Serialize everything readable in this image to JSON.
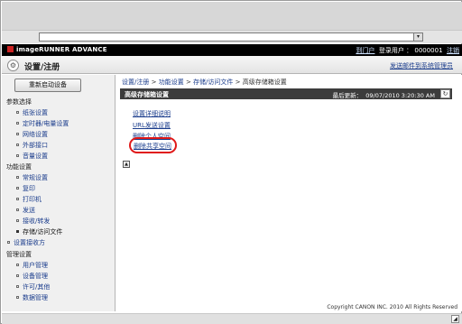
{
  "browser": {
    "address_dropdown_icon": "chevron-down-icon"
  },
  "header": {
    "brand": "imageRUNNER ADVANCE",
    "portal_link": "到门户",
    "login_user_label": "登录用户 ：",
    "user_id": "0000001",
    "logout_link": "注销"
  },
  "title": {
    "icon": "settings-gear-icon",
    "text": "设置/注册",
    "email_link": "发送邮件到系统管理员"
  },
  "sidebar": {
    "restart_button": "重新启动设备",
    "preferences_header": "参数选择",
    "preferences_items": [
      {
        "label": "纸张设置"
      },
      {
        "label": "定时器/电量设置"
      },
      {
        "label": "网络设置"
      },
      {
        "label": "外部接口"
      },
      {
        "label": "音量设置"
      }
    ],
    "function_header": "功能设置",
    "function_items": [
      {
        "label": "常规设置"
      },
      {
        "label": "复印"
      },
      {
        "label": "打印机"
      },
      {
        "label": "发送"
      },
      {
        "label": "接收/转发"
      },
      {
        "label": "存储/访问文件"
      }
    ],
    "dest_item": "设置接收方",
    "management_header": "管理设置",
    "management_items": [
      {
        "label": "用户管理"
      },
      {
        "label": "设备管理"
      },
      {
        "label": "许可/其他"
      },
      {
        "label": "数据管理"
      }
    ]
  },
  "content": {
    "breadcrumb": {
      "home": "设置/注册",
      "level1": "功能设置",
      "level2": "存储/访问文件",
      "current": "高级存储箱设置",
      "separator": ">"
    },
    "section_title": "高级存储箱设置",
    "last_update_label": "最后更新：",
    "last_update_value": "09/07/2010 3:20:30 AM",
    "refresh_icon": "refresh-icon",
    "links": [
      {
        "label": "设置详细说明"
      },
      {
        "label": "URL发送设置"
      },
      {
        "label": "删除个人空间"
      },
      {
        "label": "删除共享空间"
      }
    ],
    "up_icon": "arrow-up-icon"
  },
  "footer": {
    "copyright": "Copyright CANON INC. 2010 All Rights Reserved"
  },
  "colors": {
    "highlight": "#e01818",
    "link": "#1a3c8c",
    "section_bar": "#3c3c3c"
  }
}
